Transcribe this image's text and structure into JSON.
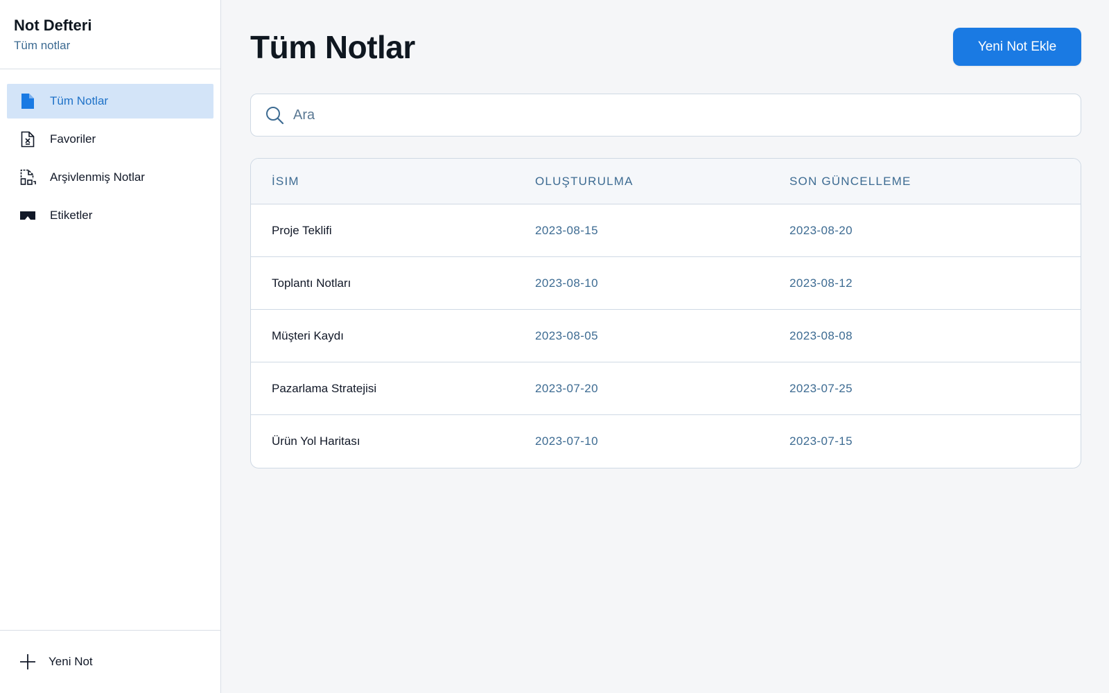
{
  "app": {
    "title": "Not Defteri",
    "subtitle": "Tüm notlar"
  },
  "sidebar": {
    "items": [
      {
        "label": "Tüm Notlar",
        "icon": "document-icon",
        "active": true
      },
      {
        "label": "Favoriler",
        "icon": "favorite-document-icon",
        "active": false
      },
      {
        "label": "Arşivlenmiş Notlar",
        "icon": "archive-document-icon",
        "active": false
      },
      {
        "label": "Etiketler",
        "icon": "tag-icon",
        "active": false
      }
    ],
    "footer_label": "Yeni Not"
  },
  "main": {
    "title": "Tüm Notlar",
    "add_button_label": "Yeni Not Ekle",
    "search": {
      "placeholder": "Ara",
      "value": ""
    },
    "table": {
      "headers": [
        "İSIM",
        "OLUŞTURULMA",
        "SON GÜNCELLEME"
      ],
      "rows": [
        {
          "name": "Proje Teklifi",
          "created": "2023-08-15",
          "updated": "2023-08-20"
        },
        {
          "name": "Toplantı Notları",
          "created": "2023-08-10",
          "updated": "2023-08-12"
        },
        {
          "name": "Müşteri Kaydı",
          "created": "2023-08-05",
          "updated": "2023-08-08"
        },
        {
          "name": "Pazarlama Stratejisi",
          "created": "2023-07-20",
          "updated": "2023-07-25"
        },
        {
          "name": "Ürün Yol Haritası",
          "created": "2023-07-10",
          "updated": "2023-07-15"
        }
      ]
    }
  },
  "colors": {
    "accent": "#1a7ae3",
    "active_bg": "#d3e4f8",
    "muted_text": "#3d6b92",
    "border": "#cfd9e4",
    "background": "#f5f6f8"
  }
}
